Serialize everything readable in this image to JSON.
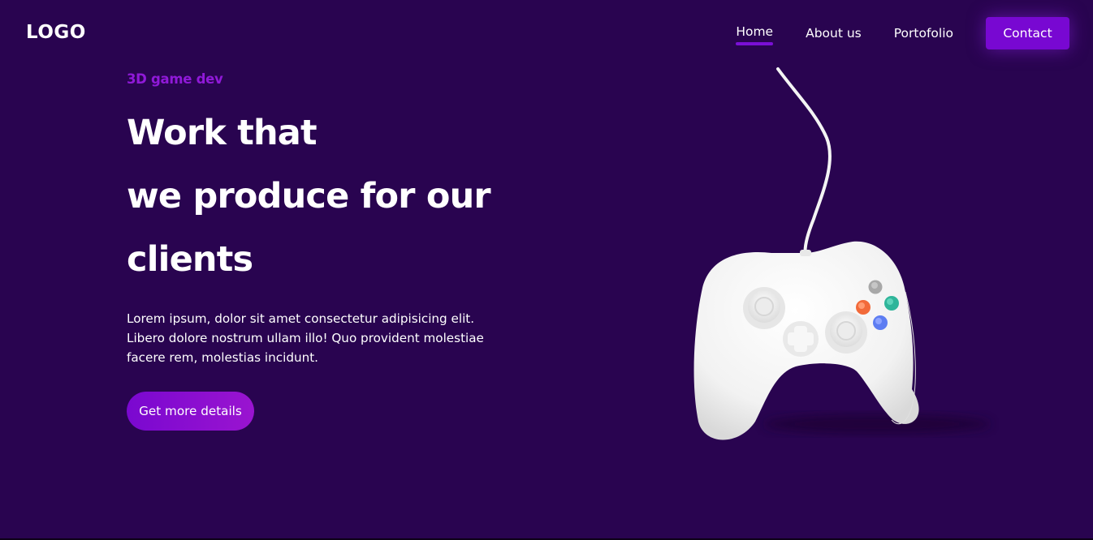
{
  "header": {
    "logo": "LOGO",
    "nav": [
      {
        "label": "Home",
        "active": true
      },
      {
        "label": "About us",
        "active": false
      },
      {
        "label": "Portofolio",
        "active": false
      }
    ],
    "contact_label": "Contact"
  },
  "hero": {
    "eyebrow": "3D game dev",
    "headline_lines": [
      "Work that",
      "we produce for our",
      "clients"
    ],
    "description": "Lorem ipsum, dolor sit amet consectetur adipisicing elit. Libero dolore nostrum ullam illo! Quo provident molestiae facere rem, molestias incidunt.",
    "cta_label": "Get more details"
  },
  "illustration": {
    "icon": "game-controller-icon"
  },
  "colors": {
    "background": "#290450",
    "accent": "#7808d2",
    "eyebrow": "#9019d8",
    "button_gray": "#a8a8a8",
    "button_teal": "#2fb59a",
    "button_orange": "#f26a3a",
    "button_blue": "#5d7df2"
  }
}
